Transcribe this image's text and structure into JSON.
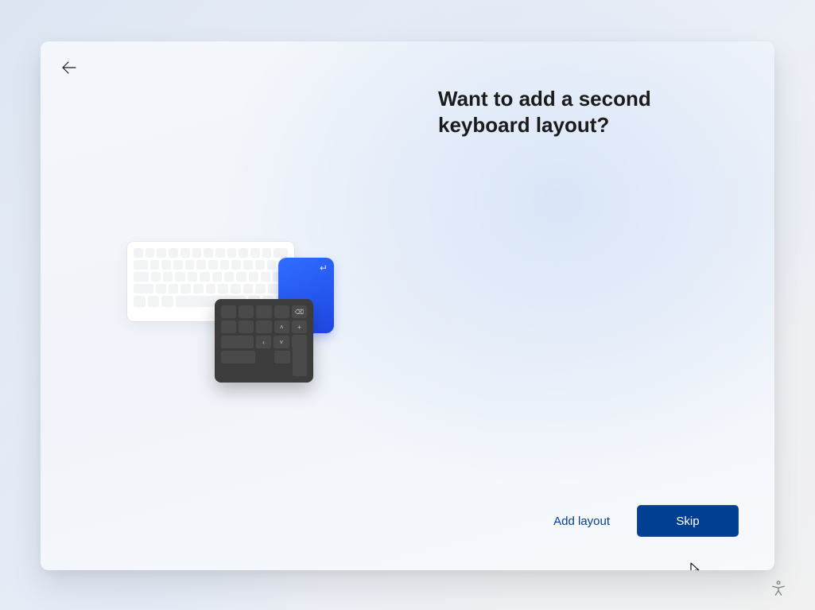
{
  "heading": "Want to add a second keyboard layout?",
  "footer": {
    "add_layout_label": "Add layout",
    "skip_label": "Skip"
  },
  "icons": {
    "back": "arrow-left-icon",
    "accessibility": "accessibility-icon",
    "enter_glyph": "↵"
  }
}
